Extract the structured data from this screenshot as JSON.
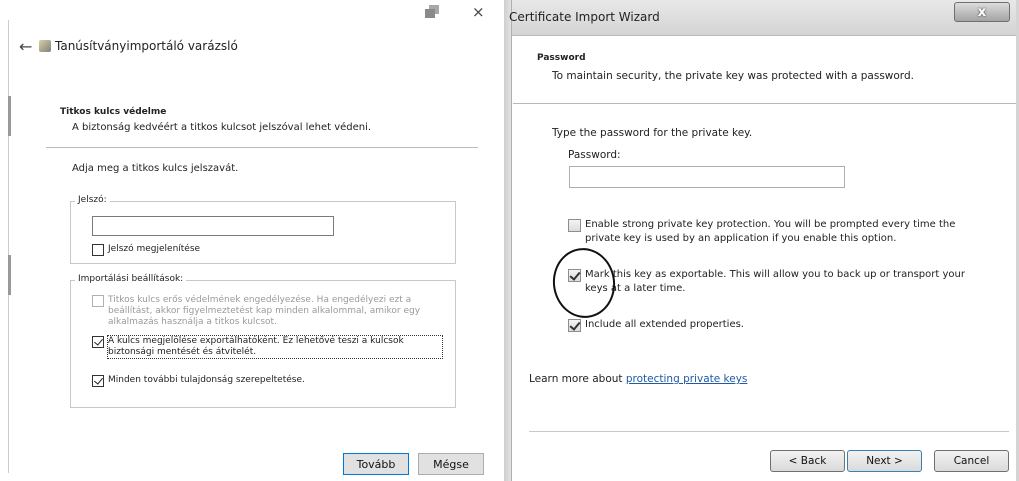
{
  "left_dialog": {
    "title": "Tanúsítványimportáló varázsló",
    "back_icon": "back-arrow-icon",
    "close_glyph": "×",
    "section_title": "Titkos kulcs védelme",
    "section_subtitle": "A biztonság kedvéért a titkos kulcsot jelszóval lehet védeni.",
    "prompt": "Adja meg a titkos kulcs jelszavát.",
    "password_group_label": "Jelszó:",
    "password_value": "",
    "show_password_label": "Jelszó megjelenítése",
    "show_password_checked": false,
    "import_options_label": "Importálási beállítások:",
    "options": [
      {
        "label": "Titkos kulcs erős védelmének engedélyezése. Ha engedélyezi ezt a beállítást, akkor figyelmeztetést kap minden alkalommal, amikor egy alkalmazás használja a titkos kulcsot.",
        "checked": false,
        "enabled": false
      },
      {
        "label": "A kulcs megjelölése exportálhatóként. Ez lehetővé teszi a kulcsok biztonsági mentését és átvitelét.",
        "checked": true,
        "enabled": true
      },
      {
        "label": "Minden további tulajdonság szerepeltetése.",
        "checked": true,
        "enabled": true
      }
    ],
    "next_button": "Tovább",
    "cancel_button": "Mégse"
  },
  "right_dialog": {
    "title": "Certificate Import Wizard",
    "close_glyph": "x",
    "section_title": "Password",
    "section_subtitle": "To maintain security, the private key was protected with a password.",
    "prompt": "Type the password for the private key.",
    "password_label": "Password:",
    "password_value": "",
    "options": [
      {
        "label": "Enable strong private key protection. You will be prompted every time the private key is used by an application if you enable this option.",
        "checked": false
      },
      {
        "label": "Mark this key as exportable. This will allow you to back up or transport your keys at a later time.",
        "checked": true
      },
      {
        "label": "Include all extended properties.",
        "checked": true
      }
    ],
    "learn_more_prefix": "Learn more about ",
    "learn_more_link": "protecting private keys",
    "back_button": "< Back",
    "next_button": "Next >",
    "cancel_button": "Cancel"
  }
}
